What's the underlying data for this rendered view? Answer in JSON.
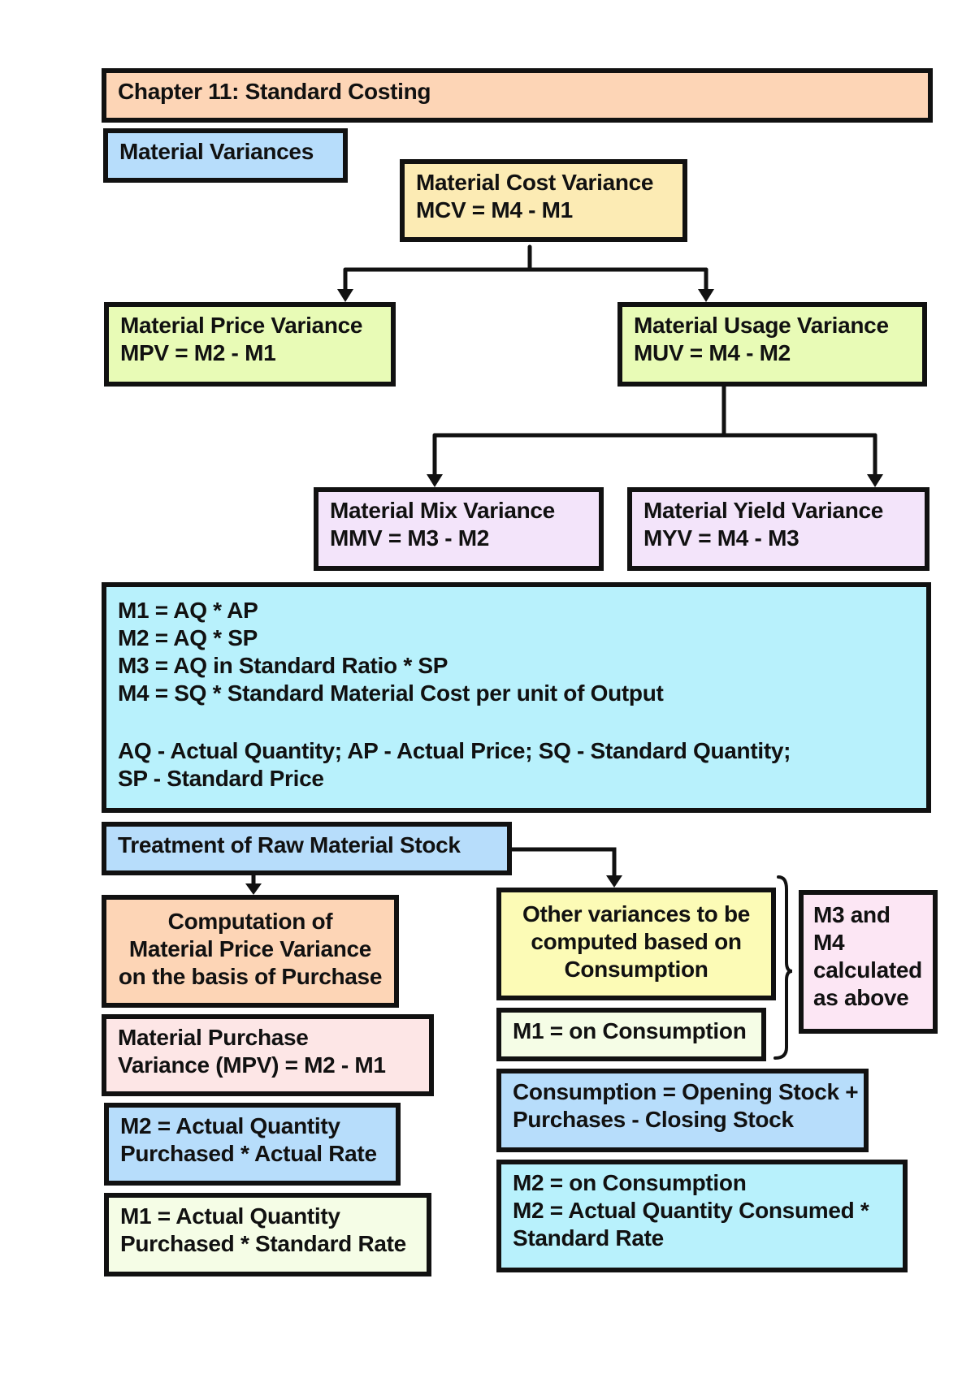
{
  "colors": {
    "peach": "#FDD5B6",
    "light_blue": "#B7DDFB",
    "butter": "#FCEBB4",
    "lime": "#E8FBB6",
    "lavender": "#F3E4FA",
    "cyan": "#B8F1FC",
    "yellow": "#FCFBB6",
    "pink": "#FCE6F4",
    "rose": "#FDE6E6",
    "cream": "#F5FDE6",
    "border": "#111111"
  },
  "title": "Chapter 11: Standard Costing",
  "section_material": "Material Variances",
  "mcv": {
    "name": "Material Cost Variance",
    "formula": "MCV = M4 - M1"
  },
  "mpv": {
    "name": "Material Price Variance",
    "formula": "MPV = M2 - M1"
  },
  "muv": {
    "name": "Material Usage Variance",
    "formula": "MUV = M4 - M2"
  },
  "mmv": {
    "name": "Material Mix Variance",
    "formula": "MMV = M3 - M2"
  },
  "myv": {
    "name": "Material Yield Variance",
    "formula": "MYV = M4 - M3"
  },
  "definitions": {
    "lines": [
      "M1  = AQ * AP",
      "M2 = AQ * SP",
      "M3 = AQ in Standard Ratio * SP",
      "M4 = SQ * Standard Material Cost per unit of Output"
    ],
    "legend": [
      "AQ - Actual Quantity; AP - Actual Price; SQ - Standard Quantity;",
      "SP - Standard Price"
    ]
  },
  "section_stock": "Treatment of Raw Material Stock",
  "purchase_basis": {
    "heading": [
      "Computation of",
      "Material Price Variance",
      "on the basis of Purchase"
    ],
    "mpv": [
      "Material Purchase",
      "Variance (MPV) = M2 - M1"
    ],
    "m2": [
      "M2 = Actual Quantity",
      "Purchased * Actual Rate"
    ],
    "m1": [
      "M1  = Actual Quantity",
      "Purchased * Standard Rate"
    ]
  },
  "consumption_basis": {
    "heading": [
      "Other variances to be",
      "computed based on",
      "Consumption"
    ],
    "m1": "M1  = on Consumption",
    "m3_m4_note": [
      "M3 and",
      "M4",
      "calculated",
      "as above"
    ],
    "consumption": [
      "Consumption = Opening Stock +",
      "Purchases - Closing Stock"
    ],
    "m2": [
      "M2 = on Consumption",
      "M2 = Actual Quantity Consumed *",
      "Standard Rate"
    ]
  }
}
